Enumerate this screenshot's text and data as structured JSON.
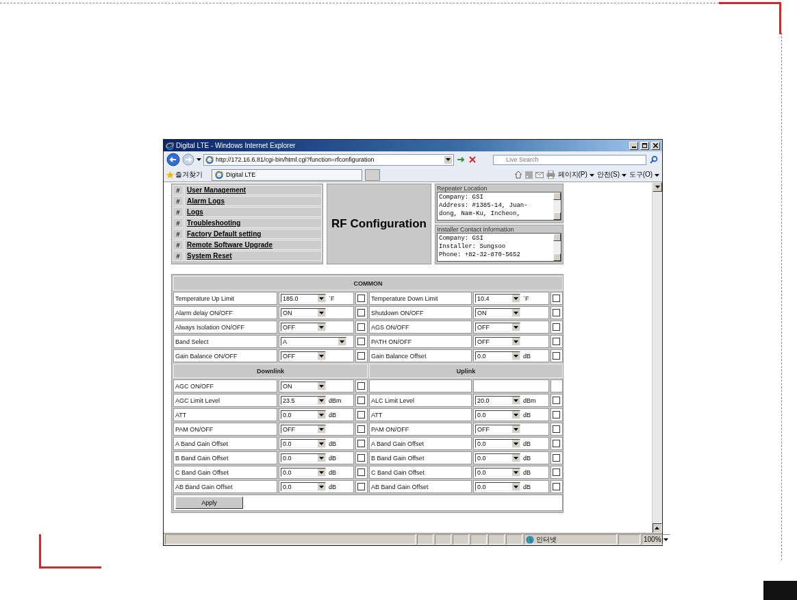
{
  "window": {
    "title": "Digital LTE - Windows Internet Explorer"
  },
  "address_bar": {
    "value": "http://172.16.6.81/cgi-bin/html.cgi?function=rfconfiguration"
  },
  "search": {
    "placeholder": "Live Search"
  },
  "favorites": {
    "label": "즐겨찾기"
  },
  "tabs": [
    {
      "label": "Digital LTE",
      "selected": true
    }
  ],
  "command_menus": [
    "페이지(P)",
    "안전(S)",
    "도구(O)"
  ],
  "menu_items": [
    {
      "marker": "#",
      "label": "User Management"
    },
    {
      "marker": "#",
      "label": "Alarm Logs"
    },
    {
      "marker": "#",
      "label": "Logs"
    },
    {
      "marker": "#",
      "label": "Troubleshooting"
    },
    {
      "marker": "#",
      "label": "Factory Default setting"
    },
    {
      "marker": "#",
      "label": "Remote Software Upgrade"
    },
    {
      "marker": "#",
      "label": "System Reset"
    }
  ],
  "page_title": "RF Configuration",
  "info_panels": [
    {
      "title": "Repeater Location",
      "lines": [
        "Company: GSI",
        "Address: #1385-14, Juan-",
        "dong, Nam-Ku, Incheon,"
      ]
    },
    {
      "title": "Installer Contact Information",
      "lines": [
        "Company: GSI",
        "Installer: Sungsoo",
        "Phone: +82-32-870-5652"
      ]
    }
  ],
  "common": {
    "heading": "COMMON",
    "rows": [
      {
        "left": {
          "label": "Temperature Up Limit",
          "value": "185.0",
          "unit": "`F",
          "checked": false
        },
        "right": {
          "label": "Temperature Down Limit",
          "value": "10.4",
          "unit": "`F",
          "checked": false
        }
      },
      {
        "left": {
          "label": "Alarm delay ON/OFF",
          "value": "ON",
          "checked": false
        },
        "right": {
          "label": "Shutdown ON/OFF",
          "value": "ON",
          "checked": false
        }
      },
      {
        "left": {
          "label": "Always Isolation ON/OFF",
          "value": "OFF",
          "checked": false
        },
        "right": {
          "label": "AGS ON/OFF",
          "value": "OFF",
          "checked": false
        }
      },
      {
        "left": {
          "label": "Band Select",
          "value": "A",
          "wide": true,
          "checked": false
        },
        "right": {
          "label": "PATH ON/OFF",
          "value": "OFF",
          "checked": false
        }
      },
      {
        "left": {
          "label": "Gain Balance ON/OFF",
          "value": "OFF",
          "checked": false
        },
        "right": {
          "label": "Gain Balance Offset",
          "value": "0.0",
          "unit": "dB",
          "checked": false
        }
      }
    ]
  },
  "links": {
    "headings": [
      "Downlink",
      "Uplink"
    ],
    "rows": [
      {
        "left": {
          "label": "AGC ON/OFF",
          "value": "ON",
          "checked": false
        },
        "right": null
      },
      {
        "left": {
          "label": "AGC Limit Level",
          "value": "23.5",
          "unit": "dBm",
          "checked": false
        },
        "right": {
          "label": "ALC Limit Level",
          "value": "20.0",
          "unit": "dBm",
          "checked": false
        }
      },
      {
        "left": {
          "label": "ATT",
          "value": "0.0",
          "unit": "dB",
          "checked": false
        },
        "right": {
          "label": "ATT",
          "value": "0.0",
          "unit": "dB",
          "checked": false
        }
      },
      {
        "left": {
          "label": "PAM ON/OFF",
          "value": "OFF",
          "checked": false
        },
        "right": {
          "label": "PAM ON/OFF",
          "value": "OFF",
          "checked": false
        }
      },
      {
        "left": {
          "label": "A Band Gain Offset",
          "value": "0.0",
          "unit": "dB",
          "checked": false
        },
        "right": {
          "label": "A Band Gain Offset",
          "value": "0.0",
          "unit": "dB",
          "checked": false
        }
      },
      {
        "left": {
          "label": "B Band Gain Offset",
          "value": "0.0",
          "unit": "dB",
          "checked": false
        },
        "right": {
          "label": "B Band Gain Offset",
          "value": "0.0",
          "unit": "dB",
          "checked": false
        }
      },
      {
        "left": {
          "label": "C Band Gain Offset",
          "value": "0.0",
          "unit": "dB",
          "checked": false
        },
        "right": {
          "label": "C Band Gain Offset",
          "value": "0.0",
          "unit": "dB",
          "checked": false
        }
      },
      {
        "left": {
          "label": "AB Band Gain Offset",
          "value": "0.0",
          "unit": "dB",
          "checked": false
        },
        "right": {
          "label": "AB Band Gain Offset",
          "value": "0.0",
          "unit": "dB",
          "checked": false
        }
      }
    ]
  },
  "apply_button": {
    "label": "Apply"
  },
  "status_bar": {
    "zone": "인터넷",
    "zoom": "100%"
  }
}
